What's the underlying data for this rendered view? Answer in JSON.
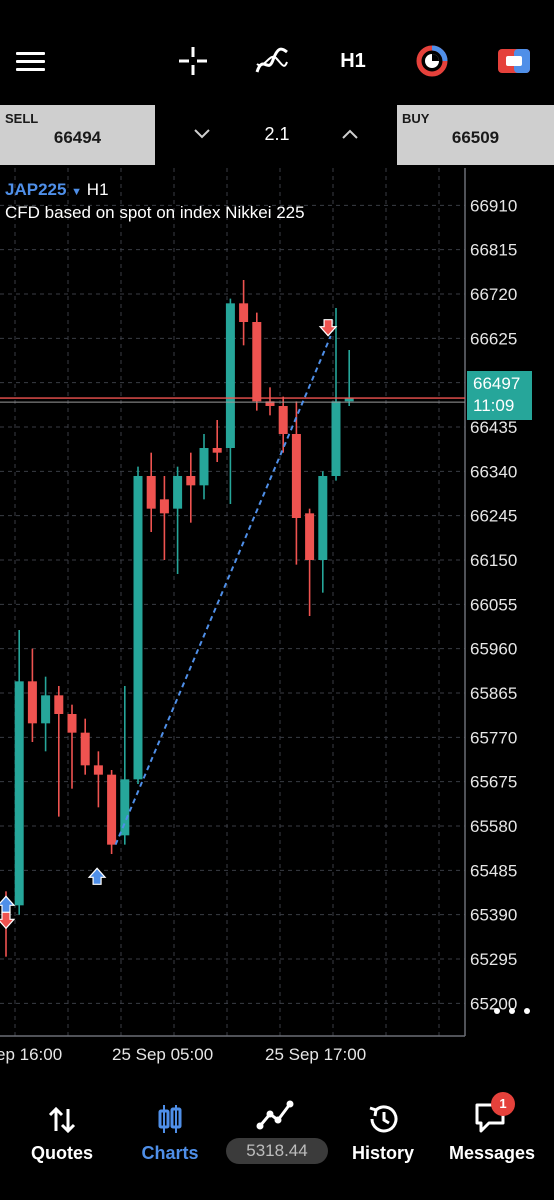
{
  "toolbar": {
    "timeframe": "H1",
    "icons": [
      "menu-icon",
      "crosshair-icon",
      "indicator-icon",
      "clock-icon",
      "trade-icon"
    ]
  },
  "trade": {
    "sell_label": "SELL",
    "sell_price": "66494",
    "buy_label": "BUY",
    "buy_price": "66509",
    "volume": "2.1"
  },
  "chart": {
    "symbol": "JAP225",
    "timeframe": "H1",
    "description": "CFD based on spot on index Nikkei 225",
    "current_price": "66497",
    "countdown": "11:09",
    "colors": {
      "bull": "#26a69a",
      "bear": "#ef5350",
      "grid": "#3a3d45",
      "accent": "#4f8fe8"
    }
  },
  "chart_data": {
    "type": "candlestick",
    "y_ticks": [
      66910,
      66815,
      66720,
      66625,
      66530,
      66435,
      66340,
      66245,
      66150,
      66055,
      65960,
      65865,
      65770,
      65675,
      65580,
      65485,
      65390,
      65295,
      65200
    ],
    "y_tick_labels": [
      "66910",
      "66815",
      "66720",
      "66625",
      "66530",
      "66435",
      "66340",
      "66245",
      "66150",
      "66055",
      "65960",
      "65865",
      "65770",
      "65675",
      "65580",
      "65485",
      "65390",
      "65295",
      "65200"
    ],
    "x_tick_labels": [
      "ep 16:00",
      "25 Sep 05:00",
      "25 Sep 17:00"
    ],
    "ylim": [
      65130,
      66990
    ],
    "current_price": 66497,
    "grid": true,
    "candles": [
      {
        "o": 65420,
        "h": 65440,
        "l": 65300,
        "c": 65370
      },
      {
        "o": 65410,
        "h": 66000,
        "l": 65390,
        "c": 65890
      },
      {
        "o": 65890,
        "h": 65960,
        "l": 65760,
        "c": 65800
      },
      {
        "o": 65800,
        "h": 65900,
        "l": 65740,
        "c": 65860
      },
      {
        "o": 65860,
        "h": 65880,
        "l": 65600,
        "c": 65820
      },
      {
        "o": 65820,
        "h": 65840,
        "l": 65660,
        "c": 65780
      },
      {
        "o": 65780,
        "h": 65810,
        "l": 65690,
        "c": 65710
      },
      {
        "o": 65710,
        "h": 65740,
        "l": 65620,
        "c": 65690
      },
      {
        "o": 65690,
        "h": 65700,
        "l": 65520,
        "c": 65540
      },
      {
        "o": 65560,
        "h": 65880,
        "l": 65540,
        "c": 65680
      },
      {
        "o": 65680,
        "h": 66350,
        "l": 65670,
        "c": 66330
      },
      {
        "o": 66330,
        "h": 66380,
        "l": 66210,
        "c": 66260
      },
      {
        "o": 66280,
        "h": 66330,
        "l": 66150,
        "c": 66250
      },
      {
        "o": 66260,
        "h": 66350,
        "l": 66120,
        "c": 66330
      },
      {
        "o": 66330,
        "h": 66380,
        "l": 66230,
        "c": 66310
      },
      {
        "o": 66310,
        "h": 66420,
        "l": 66280,
        "c": 66390
      },
      {
        "o": 66390,
        "h": 66450,
        "l": 66360,
        "c": 66380
      },
      {
        "o": 66390,
        "h": 66710,
        "l": 66270,
        "c": 66700
      },
      {
        "o": 66700,
        "h": 66750,
        "l": 66610,
        "c": 66660
      },
      {
        "o": 66660,
        "h": 66680,
        "l": 66470,
        "c": 66490
      },
      {
        "o": 66490,
        "h": 66520,
        "l": 66460,
        "c": 66480
      },
      {
        "o": 66480,
        "h": 66500,
        "l": 66380,
        "c": 66420
      },
      {
        "o": 66420,
        "h": 66490,
        "l": 66140,
        "c": 66240
      },
      {
        "o": 66250,
        "h": 66260,
        "l": 66030,
        "c": 66150
      },
      {
        "o": 66150,
        "h": 66340,
        "l": 66080,
        "c": 66330
      },
      {
        "o": 66330,
        "h": 66690,
        "l": 66320,
        "c": 66490
      },
      {
        "o": 66490,
        "h": 66600,
        "l": 66480,
        "c": 66497
      }
    ],
    "trade_line": {
      "from": {
        "candle": 8.3,
        "price": 65540
      },
      "to": {
        "candle": 24.6,
        "price": 66630
      }
    },
    "markers": [
      {
        "type": "buy",
        "candle": 6.9,
        "price": 65470
      },
      {
        "type": "sell",
        "candle": 24.4,
        "price": 66650
      },
      {
        "type": "buy",
        "candle": 0.0,
        "price": 65410
      },
      {
        "type": "sell",
        "candle": 0.0,
        "price": 65380
      }
    ]
  },
  "nav": {
    "quotes": "Quotes",
    "charts": "Charts",
    "balance": "5318.44",
    "history": "History",
    "messages": "Messages",
    "messages_badge": "1"
  }
}
